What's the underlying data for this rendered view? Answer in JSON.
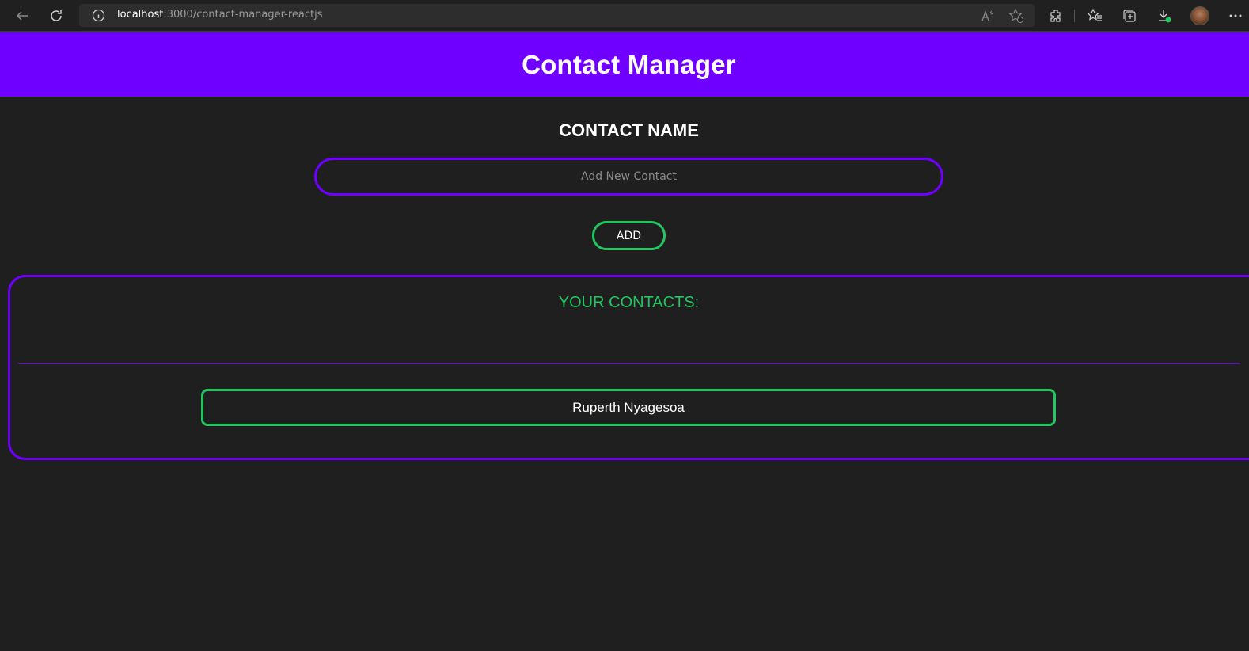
{
  "browser": {
    "url_host": "localhost",
    "url_path": ":3000/contact-manager-reactjs"
  },
  "app": {
    "title": "Contact Manager"
  },
  "form": {
    "label": "CONTACT NAME",
    "input_value": "",
    "input_placeholder": "Add New Contact",
    "add_label": "ADD"
  },
  "contacts": {
    "heading": "YOUR CONTACTS:",
    "items": [
      {
        "name": "Ruperth Nyagesoa"
      }
    ]
  },
  "colors": {
    "accent_purple": "#6f00ff",
    "accent_green": "#22c55e",
    "background": "#1f1f1f"
  }
}
